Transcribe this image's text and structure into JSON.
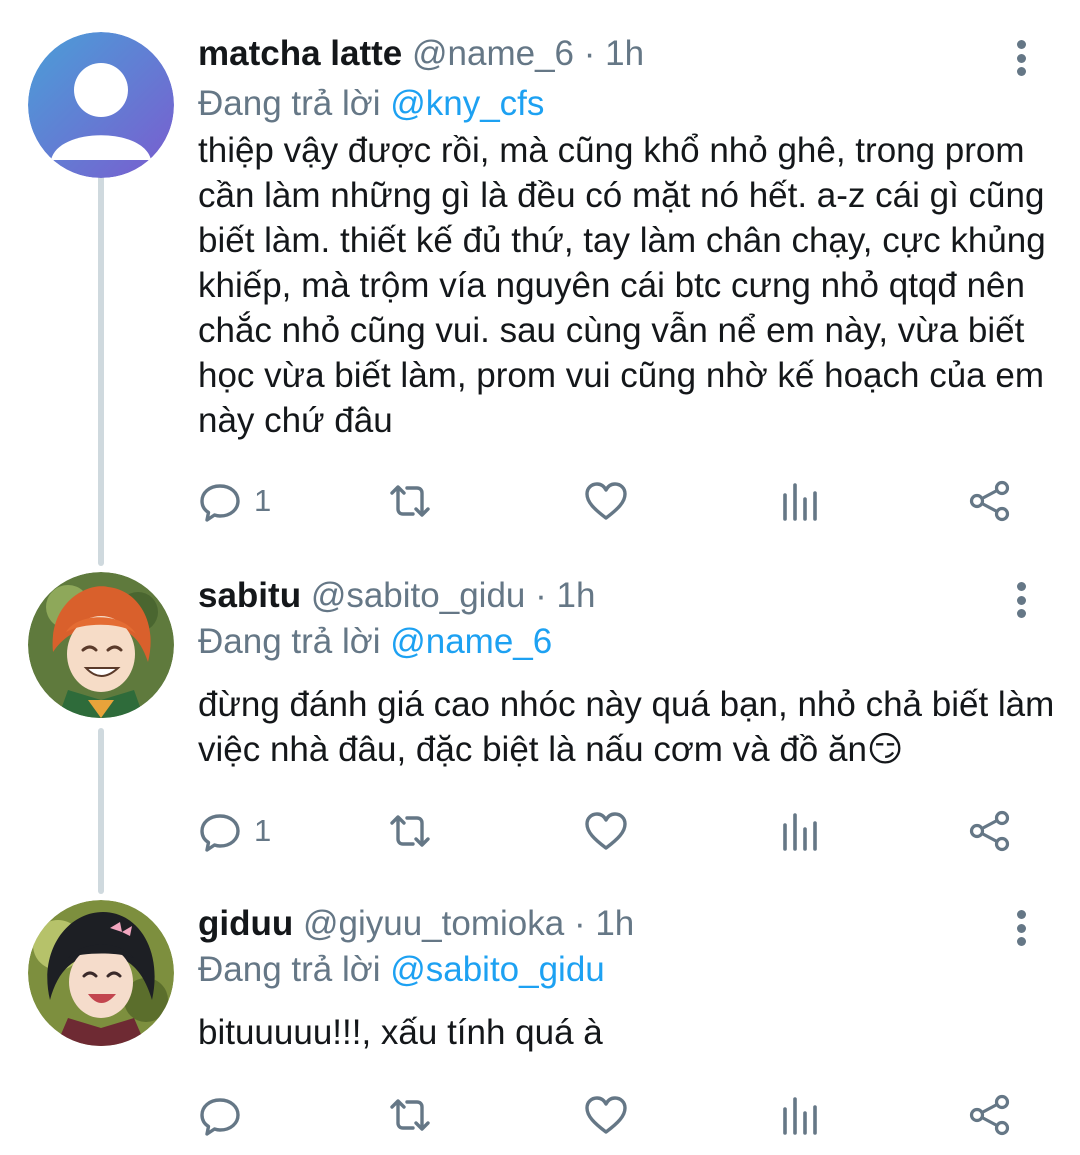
{
  "tweets": [
    {
      "name": "matcha latte",
      "handle": "@name_6",
      "time": "1h",
      "reply_prefix": "Đang trả lời",
      "reply_to": "@kny_cfs",
      "text": "thiệp vậy được rồi, mà cũng khổ nhỏ ghê, trong prom cần làm những gì là đều có mặt nó hết. a-z cái gì cũng biết làm. thiết kế đủ thứ, tay làm chân chạy, cực khủng khiếp, mà trộm vía nguyên cái btc cưng nhỏ qtqđ nên chắc nhỏ cũng vui. sau cùng vẫn nể em này, vừa biết học vừa biết làm, prom vui cũng nhờ kế hoạch của em này chứ đâu",
      "reply_count": "1",
      "avatar": "default-avatar"
    },
    {
      "name": "sabitu",
      "handle": "@sabito_gidu",
      "time": "1h",
      "reply_prefix": "Đang trả lời",
      "reply_to": "@name_6",
      "text": "đừng đánh giá cao nhóc này quá bạn, nhỏ chả biết làm việc nhà đâu, đặc biệt là nấu cơm và đồ ăn😏",
      "reply_count": "1",
      "avatar": "orange-hair-avatar"
    },
    {
      "name": "giduu",
      "handle": "@giyuu_tomioka",
      "time": "1h",
      "reply_prefix": "Đang trả lời",
      "reply_to": "@sabito_gidu",
      "text": "bituuuuu!!!, xấu tính quá à",
      "reply_count": "",
      "avatar": "dark-hair-avatar"
    }
  ],
  "separator": "·",
  "colors": {
    "accent": "#1da1f2",
    "secondary": "#657786",
    "line": "#cfd9de"
  },
  "icons": [
    "reply-icon",
    "retweet-icon",
    "like-icon",
    "analytics-icon",
    "share-icon",
    "more-icon"
  ]
}
